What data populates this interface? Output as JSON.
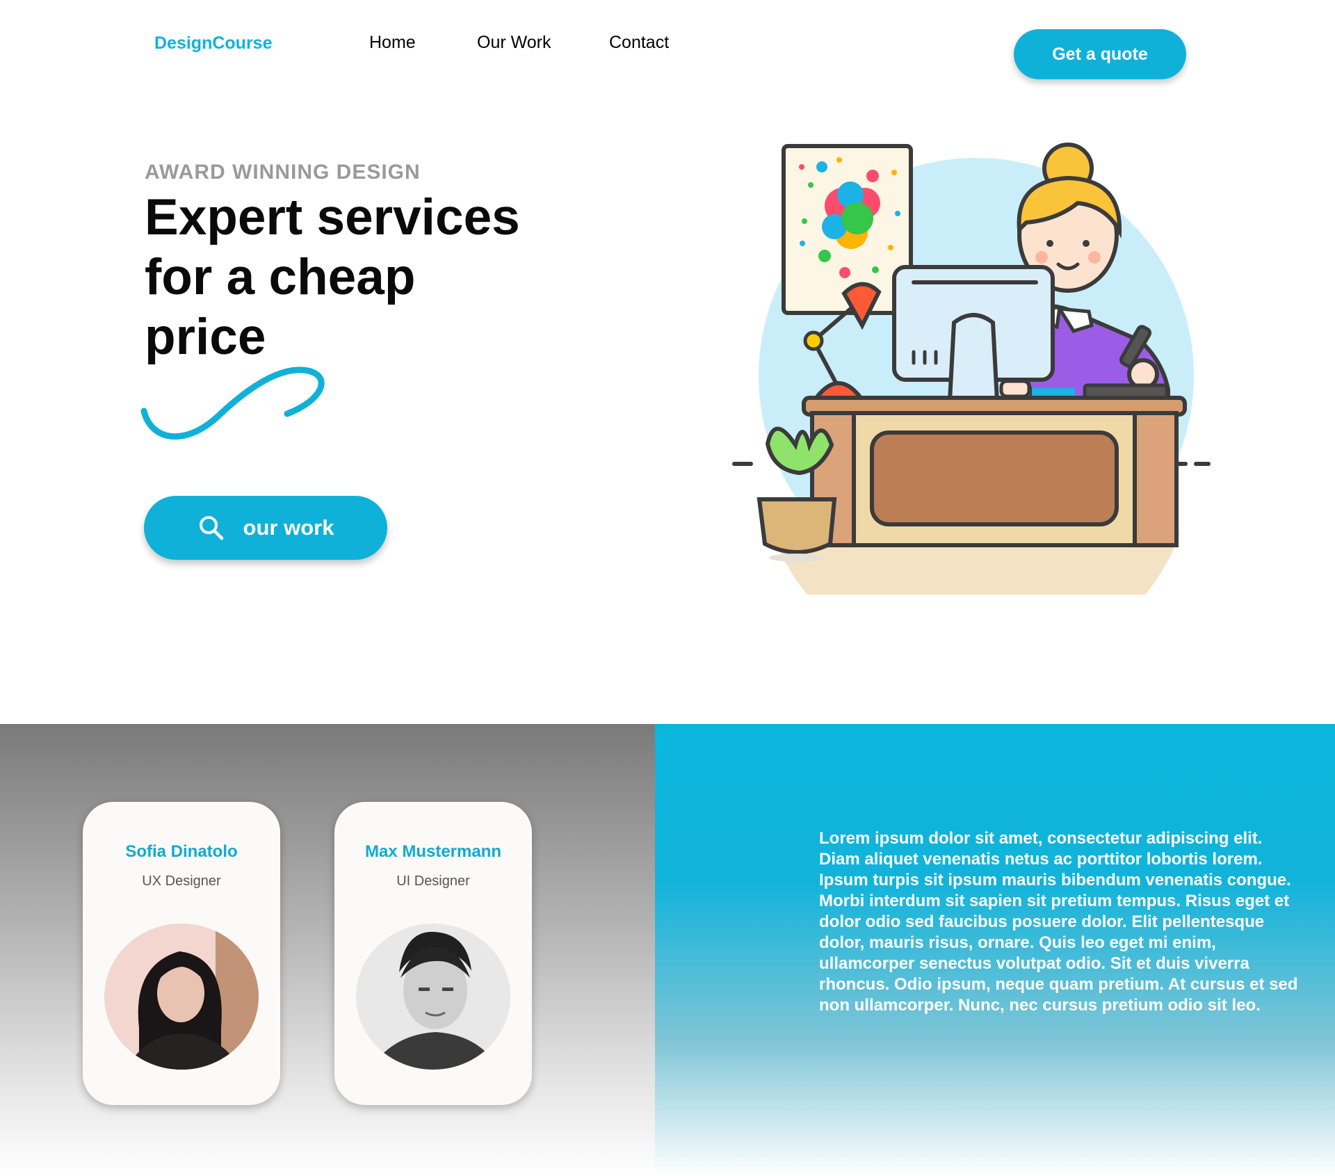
{
  "nav": {
    "logo": "DesignCourse",
    "links": [
      "Home",
      "Our Work",
      "Contact"
    ],
    "cta": "Get a quote"
  },
  "hero": {
    "eyebrow": "AWARD WINNING DESIGN",
    "headline_lines": [
      "Expert services",
      "for a cheap",
      "price"
    ],
    "button_label": "our work",
    "button_icon": "search-icon"
  },
  "team": [
    {
      "name": "Sofia Dinatolo",
      "role": "UX Designer"
    },
    {
      "name": "Max Mustermann",
      "role": "UI Designer"
    }
  ],
  "info": {
    "text": "Lorem ipsum dolor sit amet, consectetur adipiscing elit. Diam aliquet venenatis netus ac porttitor lobortis lorem. Ipsum turpis sit ipsum mauris bibendum venenatis congue. Morbi interdum sit sapien sit pretium tempus. Risus eget et dolor odio sed faucibus posuere dolor. Elit pellentesque dolor, mauris risus, ornare. Quis leo eget mi enim, ullamcorper senectus volutpat odio. Sit et duis viverra rhoncus. Odio ipsum, neque quam pretium. At cursus et sed non ullamcorper. Nunc, nec cursus pretium odio sit leo."
  },
  "colors": {
    "accent": "#10b1d8",
    "eyebrow": "#9a9a9a",
    "card_name": "#12a9d2"
  }
}
